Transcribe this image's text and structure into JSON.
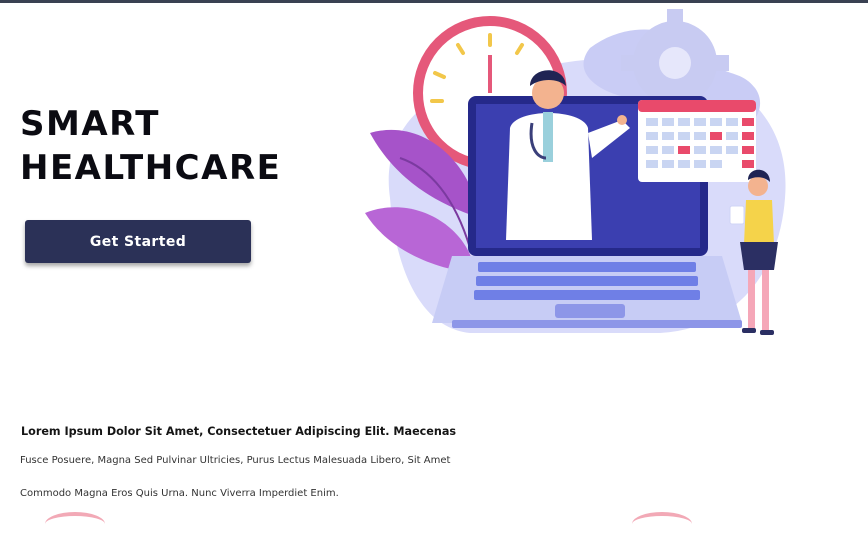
{
  "hero": {
    "title_line1": "SMART",
    "title_line2": "HEALTHCARE",
    "cta_label": "Get Started"
  },
  "intro": {
    "heading": "Lorem Ipsum Dolor Sit Amet, Consectetuer Adipiscing Elit. Maecenas",
    "line1": "Fusce Posuere, Magna Sed Pulvinar Ultricies, Purus Lectus Malesuada Libero, Sit Amet",
    "line2": "Commodo Magna Eros Quis Urna. Nunc Viverra Imperdiet Enim."
  },
  "colors": {
    "accent_navy": "#2b3157",
    "laptop_blue": "#3b3fb0",
    "calendar_red": "#e94a6b",
    "clock_pink": "#e5587a"
  }
}
